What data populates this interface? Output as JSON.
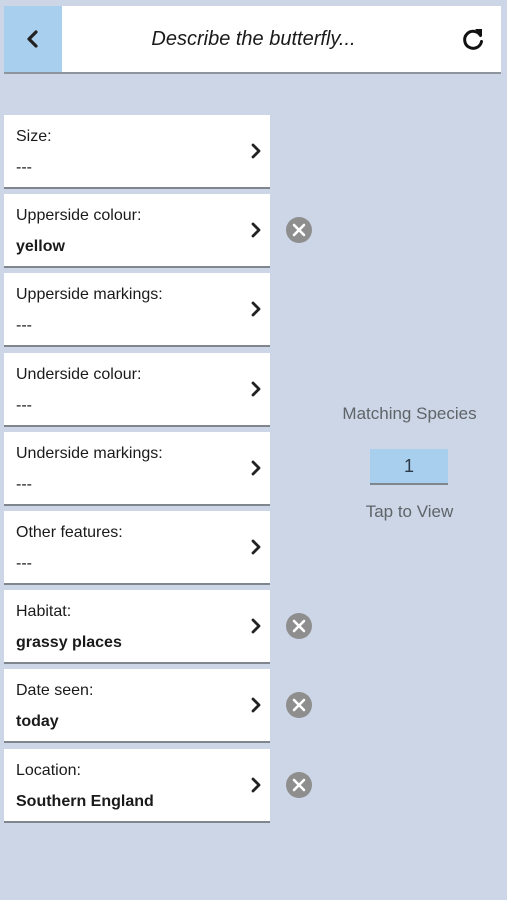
{
  "header": {
    "title": "Describe the butterfly...",
    "back_icon": "chevron-left-icon",
    "refresh_icon": "refresh-icon"
  },
  "fields": [
    {
      "label": "Size:",
      "value": "---",
      "set": false
    },
    {
      "label": "Upperside colour:",
      "value": "yellow",
      "set": true
    },
    {
      "label": "Upperside markings:",
      "value": "---",
      "set": false
    },
    {
      "label": "Underside colour:",
      "value": "---",
      "set": false
    },
    {
      "label": "Underside markings:",
      "value": "---",
      "set": false
    },
    {
      "label": "Other features:",
      "value": "---",
      "set": false
    },
    {
      "label": "Habitat:",
      "value": "grassy places",
      "set": true
    },
    {
      "label": "Date seen:",
      "value": "today",
      "set": true
    },
    {
      "label": "Location:",
      "value": "Southern England",
      "set": true
    }
  ],
  "matches": {
    "title": "Matching Species",
    "count": "1",
    "action": "Tap to View"
  },
  "colors": {
    "background": "#ccd6e6",
    "accent": "#a8cfee",
    "clear_icon": "#8e8e8e"
  }
}
